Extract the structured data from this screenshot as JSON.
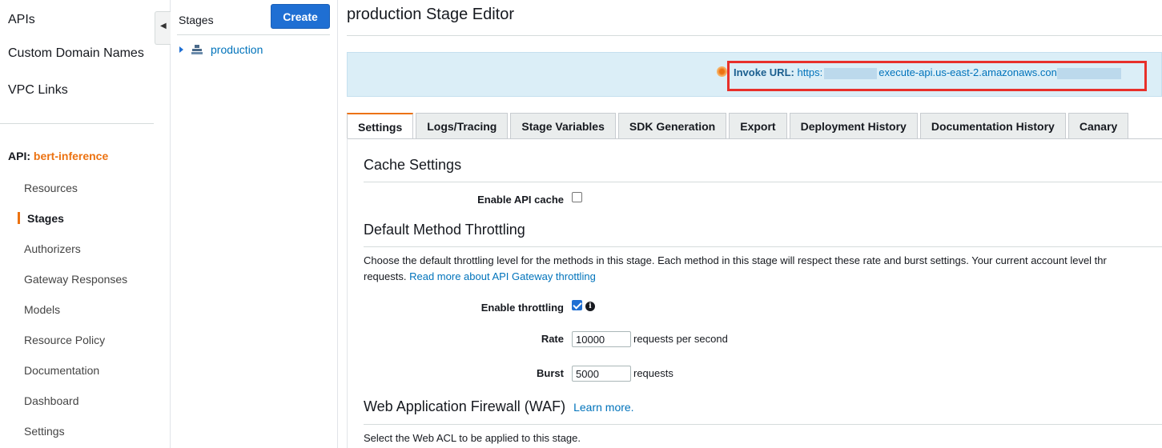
{
  "leftnav": {
    "top_items": [
      "APIs",
      "Custom Domain Names",
      "VPC Links"
    ],
    "api_prefix": "API:",
    "api_name": "bert-inference",
    "sub_items": [
      "Resources",
      "Stages",
      "Authorizers",
      "Gateway Responses",
      "Models",
      "Resource Policy",
      "Documentation",
      "Dashboard",
      "Settings"
    ],
    "active_item": "Stages",
    "collapse_icon": "chevron-left-icon"
  },
  "stages": {
    "title": "Stages",
    "create_label": "Create",
    "items": [
      {
        "label": "production",
        "icon": "stage-icon"
      }
    ]
  },
  "main": {
    "title": "production Stage Editor",
    "invoke": {
      "label": "Invoke URL:",
      "url_prefix": "https:",
      "url_middle": "execute-api.us-east-2.amazonaws.con",
      "highlight_color": "#e8302a"
    },
    "tabs": [
      "Settings",
      "Logs/Tracing",
      "Stage Variables",
      "SDK Generation",
      "Export",
      "Deployment History",
      "Documentation History",
      "Canary"
    ],
    "active_tab": "Settings",
    "cache": {
      "title": "Cache Settings",
      "enable_label": "Enable API cache",
      "enabled": false
    },
    "throttling": {
      "title": "Default Method Throttling",
      "description_line1": "Choose the default throttling level for the methods in this stage. Each method in this stage will respect these rate and burst settings. Your current account level thr",
      "description_line2": "requests.",
      "link": "Read more about API Gateway throttling",
      "enable_label": "Enable throttling",
      "enabled": true,
      "rate_label": "Rate",
      "rate_value": "10000",
      "rate_unit": "requests per second",
      "burst_label": "Burst",
      "burst_value": "5000",
      "burst_unit": "requests"
    },
    "waf": {
      "title": "Web Application Firewall (WAF)",
      "learn_more": "Learn more.",
      "description": "Select the Web ACL to be applied to this stage."
    }
  },
  "colors": {
    "accent": "#ec7211",
    "primary_button": "#1f6fd3",
    "link": "#0073bb",
    "info_box": "#dbeef7"
  }
}
